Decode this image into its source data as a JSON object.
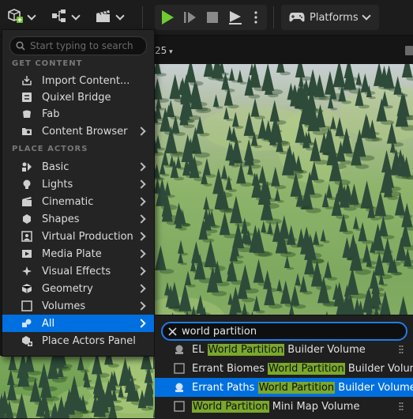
{
  "toolbar": {
    "add_content": {
      "icon": "add-cube-icon"
    },
    "blueprints": {
      "icon": "blueprint-icon"
    },
    "cinematics": {
      "icon": "clapper-icon"
    },
    "play_controls": [
      "play-icon",
      "step-icon",
      "stop-icon",
      "eject-icon",
      "kebab-icon"
    ],
    "platforms_label": "Platforms"
  },
  "viewport": {
    "zoom_label": "25"
  },
  "menu": {
    "search_placeholder": "Start typing to search",
    "section_get_content": "GET CONTENT",
    "section_place_actors": "PLACE ACTORS",
    "get_content": [
      {
        "label": "Import Content...",
        "icon": "import-icon",
        "submenu": false
      },
      {
        "label": "Quixel Bridge",
        "icon": "bridge-icon",
        "submenu": false
      },
      {
        "label": "Fab",
        "icon": "fab-icon",
        "submenu": false
      },
      {
        "label": "Content Browser",
        "icon": "content-browser-icon",
        "submenu": true
      }
    ],
    "place_actors": [
      {
        "label": "Basic",
        "icon": "basic-icon",
        "submenu": true
      },
      {
        "label": "Lights",
        "icon": "light-bulb-icon",
        "submenu": true
      },
      {
        "label": "Cinematic",
        "icon": "clapper-icon",
        "submenu": true
      },
      {
        "label": "Shapes",
        "icon": "shapes-icon",
        "submenu": true
      },
      {
        "label": "Virtual Production",
        "icon": "virtual-production-icon",
        "submenu": true
      },
      {
        "label": "Media Plate",
        "icon": "media-plate-icon",
        "submenu": true
      },
      {
        "label": "Visual Effects",
        "icon": "visual-effects-icon",
        "submenu": true
      },
      {
        "label": "Geometry",
        "icon": "geometry-icon",
        "submenu": true
      },
      {
        "label": "Volumes",
        "icon": "volume-icon",
        "submenu": true
      },
      {
        "label": "All",
        "icon": "all-icon",
        "submenu": true,
        "selected": true
      },
      {
        "label": "Place Actors Panel",
        "icon": "place-actors-panel-icon",
        "submenu": false
      }
    ]
  },
  "results": {
    "filter_text": "world partition",
    "highlight_color": "#7aa82c",
    "items": [
      {
        "before": "EL ",
        "match": "World Partition",
        "after": " Builder Volume",
        "icon": "builder-volume-icon"
      },
      {
        "before": "Errant Biomes ",
        "match": "World Partition",
        "after": " Builder Volume",
        "icon": "volume-box-icon"
      },
      {
        "before": "Errant Paths ",
        "match": "World Partition",
        "after": " Builder Volume",
        "icon": "builder-volume-icon",
        "selected": true
      },
      {
        "before": "",
        "match": "World Partition",
        "after": " Mini Map Volume",
        "icon": "volume-box-icon"
      }
    ]
  },
  "colors": {
    "accent": "#0070e0",
    "background": "#242424"
  }
}
